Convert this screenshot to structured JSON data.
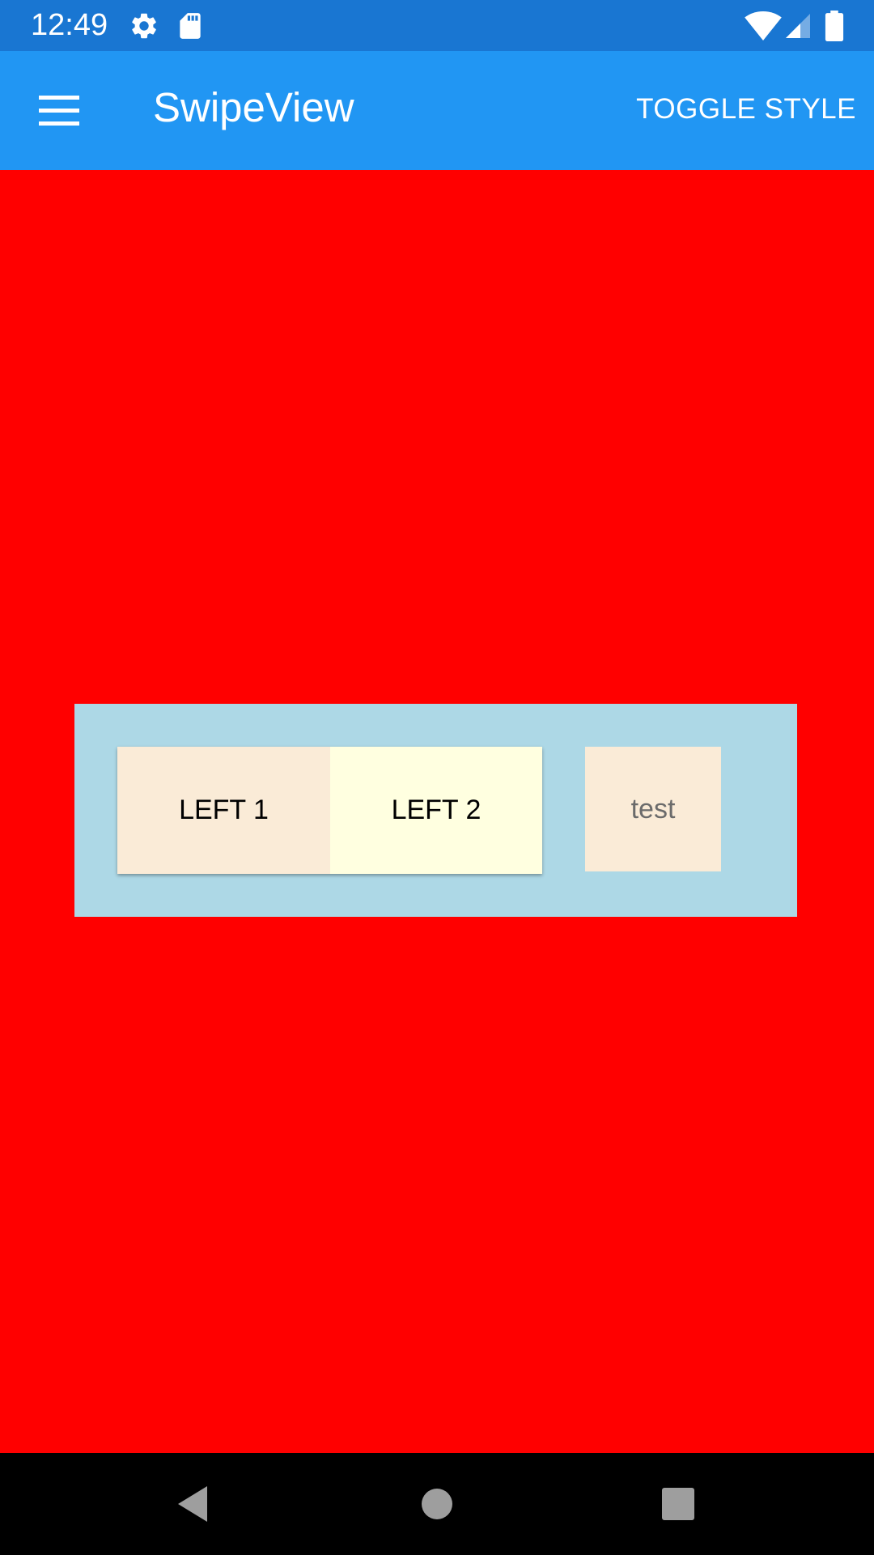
{
  "status_bar": {
    "time": "12:49",
    "icons": [
      "settings-icon",
      "sd-card-icon",
      "wifi-icon",
      "signal-icon",
      "battery-icon"
    ],
    "background_color": "#1976D2"
  },
  "app_bar": {
    "title": "SwipeView",
    "toggle_style_label": "TOGGLE STYLE",
    "menu_icon": "hamburger-menu-icon",
    "background_color": "#2196F3"
  },
  "content": {
    "background_color": "#FF0000",
    "swipe_container_color": "#ADD8E6",
    "swipe_items": [
      {
        "label": "LEFT 1",
        "color": "#FAEBD7"
      },
      {
        "label": "LEFT 2",
        "color": "#FFFFE0"
      }
    ],
    "cell_text": "test",
    "cell_color": "#FAEBD7"
  },
  "nav_bar": {
    "icons": [
      "back-icon",
      "home-icon",
      "recents-icon"
    ]
  }
}
